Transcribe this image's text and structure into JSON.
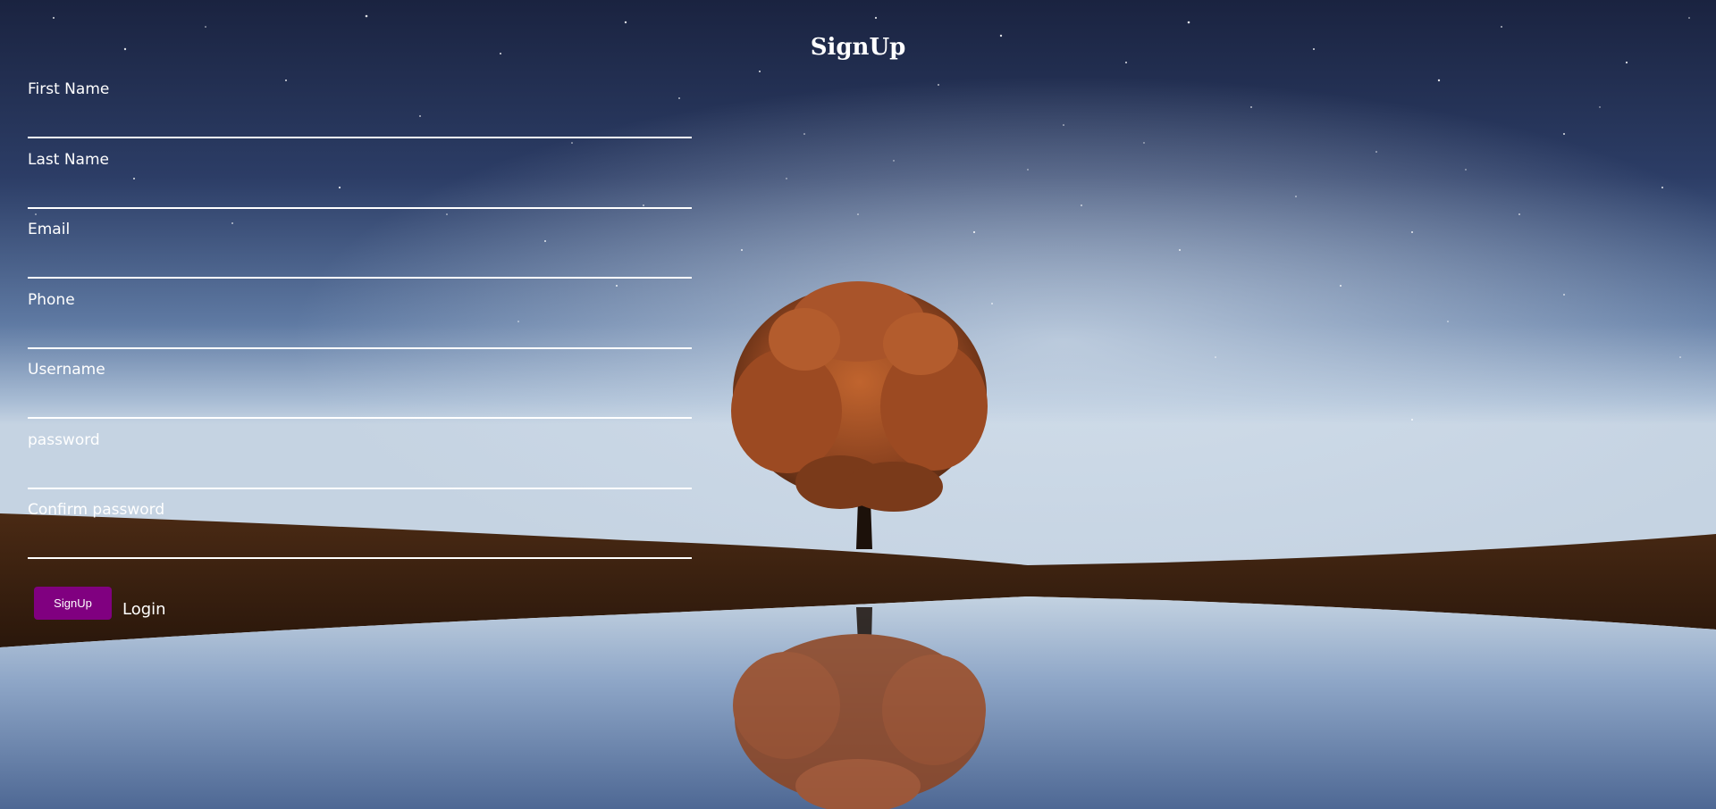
{
  "page": {
    "title": "SignUp"
  },
  "form": {
    "fields": [
      {
        "label": "First Name",
        "value": "",
        "type": "text"
      },
      {
        "label": "Last Name",
        "value": "",
        "type": "text"
      },
      {
        "label": "Email",
        "value": "",
        "type": "email"
      },
      {
        "label": "Phone",
        "value": "",
        "type": "tel"
      },
      {
        "label": "Username",
        "value": "",
        "type": "text"
      },
      {
        "label": "password",
        "value": "",
        "type": "password"
      },
      {
        "label": "Confirm password",
        "value": "",
        "type": "password"
      }
    ],
    "submit_label": "SignUp",
    "login_label": "Login"
  },
  "colors": {
    "button_bg": "#800080",
    "text": "#ffffff",
    "field_underline": "#ffffff",
    "sky_top": "#1b2440",
    "sky_horizon": "#a9bdd6",
    "ground": "#3b2313",
    "water": "#8fa6c6",
    "foliage": "#a0522d"
  },
  "background": {
    "scene": "night sky with lone tree reflected in lake"
  }
}
